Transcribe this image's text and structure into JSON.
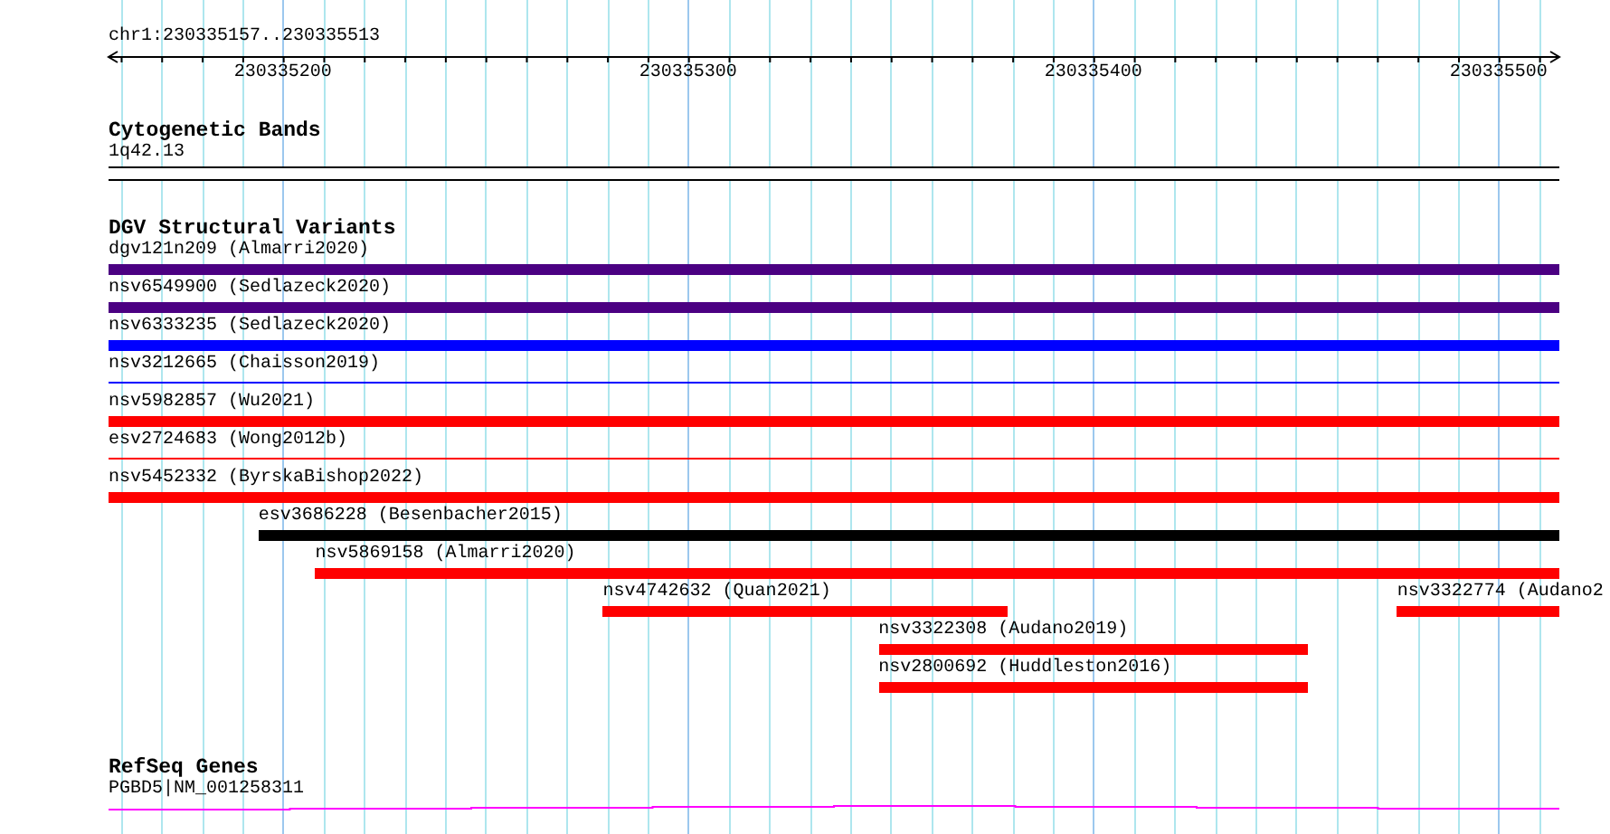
{
  "ruler": {
    "location": "chr1:230335157..230335513",
    "ticks": [
      {
        "label": "230335200"
      },
      {
        "label": "230335300"
      },
      {
        "label": "230335400"
      },
      {
        "label": "230335500"
      }
    ]
  },
  "cytogenetic_bands": {
    "title": "Cytogenetic Bands",
    "band": "1q42.13"
  },
  "dgv_structural_variants": {
    "title": "DGV Structural Variants",
    "rows": [
      {
        "features": [
          {
            "label": "dgv121n209 (Almarri2020)",
            "kind": "thick",
            "color": "#4b0082"
          }
        ]
      },
      {
        "features": [
          {
            "label": "nsv6549900 (Sedlazeck2020)",
            "kind": "thick",
            "color": "#4b0082"
          }
        ]
      },
      {
        "features": [
          {
            "label": "nsv6333235 (Sedlazeck2020)",
            "kind": "thick",
            "color": "#0000ff"
          }
        ]
      },
      {
        "features": [
          {
            "label": "nsv3212665 (Chaisson2019)",
            "kind": "thin",
            "color": "#0000ff"
          }
        ]
      },
      {
        "features": [
          {
            "label": "nsv5982857 (Wu2021)",
            "kind": "thick",
            "color": "#ff0000"
          }
        ]
      },
      {
        "features": [
          {
            "label": "esv2724683 (Wong2012b)",
            "kind": "thin",
            "color": "#ff0000"
          }
        ]
      },
      {
        "features": [
          {
            "label": "nsv5452332 (ByrskaBishop2022)",
            "kind": "thick",
            "color": "#ff0000"
          }
        ]
      },
      {
        "features": [
          {
            "label": "esv3686228 (Besenbacher2015)",
            "kind": "thick",
            "color": "#000000"
          }
        ]
      },
      {
        "features": [
          {
            "label": "nsv5869158 (Almarri2020)",
            "kind": "thick",
            "color": "#ff0000"
          }
        ]
      },
      {
        "features": [
          {
            "label": "nsv4742632 (Quan2021)",
            "kind": "thick",
            "color": "#ff0000"
          },
          {
            "label": "nsv3322774 (Audano2",
            "kind": "thick",
            "color": "#ff0000"
          }
        ]
      },
      {
        "features": [
          {
            "label": "nsv3322308 (Audano2019)",
            "kind": "thick",
            "color": "#ff0000"
          }
        ]
      },
      {
        "features": [
          {
            "label": "nsv2800692 (Huddleston2016)",
            "kind": "thick",
            "color": "#ff0000"
          }
        ]
      }
    ]
  },
  "refseq_genes": {
    "title": "RefSeq Genes",
    "genes": [
      {
        "label": "PGBD5|NM_001258311"
      }
    ]
  }
}
